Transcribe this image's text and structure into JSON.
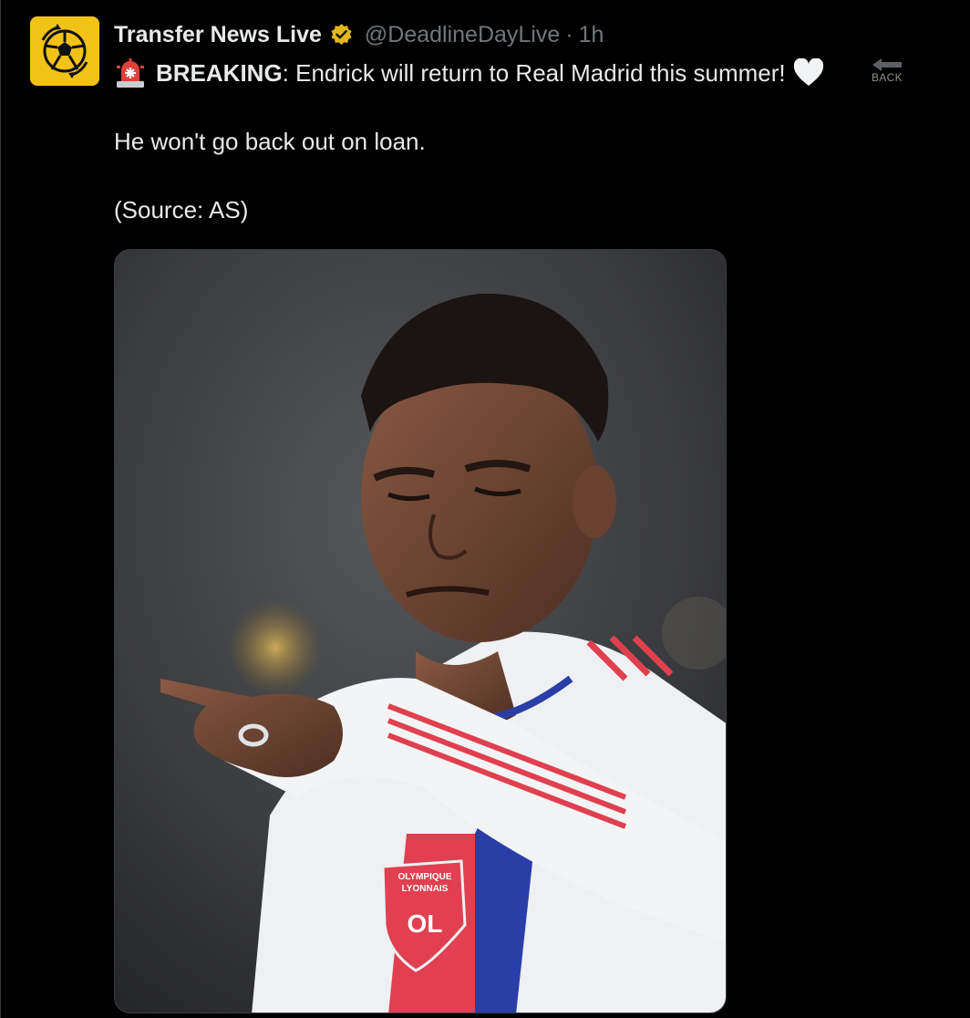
{
  "tweet": {
    "display_name": "Transfer News Live",
    "handle": "@DeadlineDayLive",
    "separator": "·",
    "time": "1h",
    "line1_prefix": "BREAKING",
    "line1_colon": ":",
    "line1_rest": " Endrick will return to Real Madrid this summer!",
    "line2": "He won't go back out on loan.",
    "line3": "(Source: AS)"
  },
  "back_button": {
    "label": "BACK"
  },
  "media": {
    "crest_line1": "OLYMPIQUE",
    "crest_line2": "LYONNAIS",
    "crest_monogram": "OL"
  },
  "icons": {
    "avatar": "football-logo-icon",
    "verified": "verified-badge-icon",
    "siren": "siren-emoji-icon",
    "heart": "white-heart-emoji-icon",
    "back": "back-arrow-icon"
  },
  "colors": {
    "background": "#000000",
    "text": "#e7e9ea",
    "muted": "#71767b",
    "avatar_bg": "#f2c316",
    "verified_gold": "#e2b719"
  }
}
